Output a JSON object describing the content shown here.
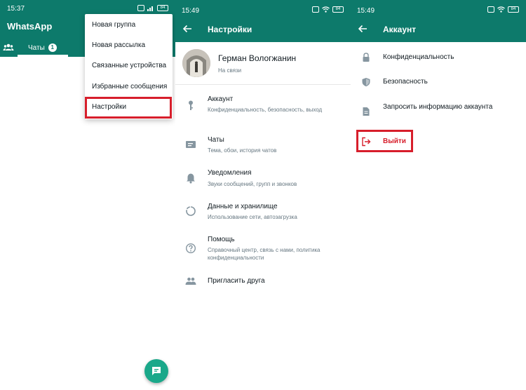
{
  "colors": {
    "header": "#0d7a6b",
    "fab": "#1aa88a",
    "highlight": "#d71e2b"
  },
  "screen1": {
    "status_time": "15:37",
    "battery": "84",
    "app_title": "WhatsApp",
    "tab_chats": "Чаты",
    "tab_badge": "1",
    "menu": [
      "Новая группа",
      "Новая рассылка",
      "Связанные устройства",
      "Избранные сообщения",
      "Настройки"
    ],
    "fab_icon": "new-chat-icon"
  },
  "screen2": {
    "status_time": "15:49",
    "battery": "84",
    "title": "Настройки",
    "profile": {
      "name": "Герман Вологжанин",
      "status": "На связи"
    },
    "items": [
      {
        "title": "Аккаунт",
        "subtitle": "Конфиденциальность, безопасность, выход",
        "icon": "key-icon"
      },
      {
        "title": "Чаты",
        "subtitle": "Тема, обои, история чатов",
        "icon": "chat-icon"
      },
      {
        "title": "Уведомления",
        "subtitle": "Звуки сообщений, групп и звонков",
        "icon": "bell-icon"
      },
      {
        "title": "Данные и хранилище",
        "subtitle": "Использование сети, автозагрузка",
        "icon": "data-usage-icon"
      },
      {
        "title": "Помощь",
        "subtitle": "Справочный центр, связь с нами, политика конфиденциальности",
        "icon": "help-icon"
      },
      {
        "title": "Пригласить друга",
        "subtitle": "",
        "icon": "people-icon"
      }
    ]
  },
  "screen3": {
    "status_time": "15:49",
    "battery": "84",
    "title": "Аккаунт",
    "items": [
      {
        "title": "Конфиденциальность",
        "icon": "lock-icon"
      },
      {
        "title": "Безопасность",
        "icon": "shield-icon"
      },
      {
        "title": "Запросить информацию аккаунта",
        "icon": "document-icon"
      },
      {
        "title": "Выйти",
        "icon": "logout-icon"
      }
    ]
  }
}
